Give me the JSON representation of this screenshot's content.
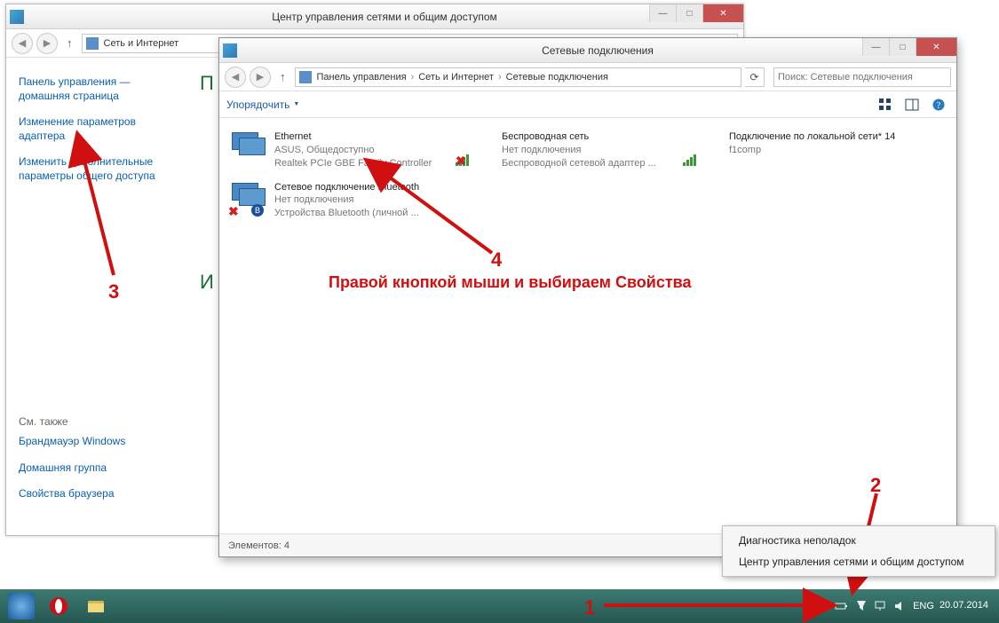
{
  "win1": {
    "title": "Центр управления сетями и общим доступом",
    "breadcrumb": "Сеть и Интернет",
    "sidebar": {
      "home": "Панель управления — домашняя страница",
      "adapter": "Изменение параметров адаптера",
      "advanced": "Изменить дополнительные параметры общего доступа",
      "seealso": "См. также",
      "firewall": "Брандмауэр Windows",
      "homegroup": "Домашняя группа",
      "browser": "Свойства браузера"
    }
  },
  "win2": {
    "title": "Сетевые подключения",
    "crumbs": [
      "Панель управления",
      "Сеть и Интернет",
      "Сетевые подключения"
    ],
    "search_placeholder": "Поиск: Сетевые подключения",
    "organize": "Упорядочить",
    "items": [
      {
        "name": "Ethernet",
        "status": "ASUS, Общедоступно",
        "dev": "Realtek PCIe GBE Family Controller"
      },
      {
        "name": "Беспроводная сеть",
        "status": "Нет подключения",
        "dev": "Беспроводной сетевой адаптер ..."
      },
      {
        "name": "Подключение по локальной сети* 14",
        "status": "f1comp",
        "dev": ""
      },
      {
        "name": "Сетевое подключение Bluetooth",
        "status": "Нет подключения",
        "dev": "Устройства Bluetooth (личной ..."
      }
    ],
    "status": "Элементов: 4"
  },
  "ctx": {
    "diag": "Диагностика неполадок",
    "center": "Центр управления сетями и общим доступом"
  },
  "anno": {
    "n1": "1",
    "n2": "2",
    "n3": "3",
    "n4": "4",
    "caption": "Правой кнопкой мыши и выбираем Свойства"
  },
  "tray": {
    "lang": "ENG",
    "date": "20.07.2014"
  }
}
